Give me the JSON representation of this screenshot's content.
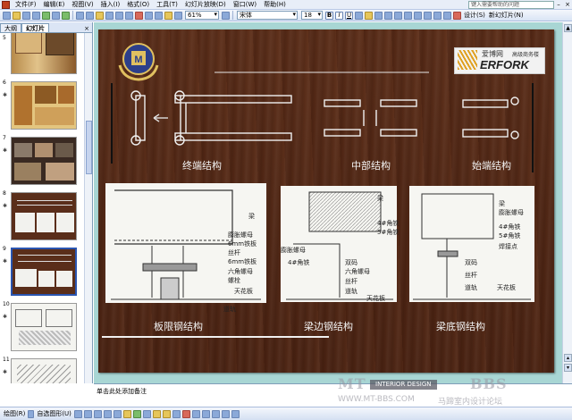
{
  "menu": [
    "文件(F)",
    "编辑(E)",
    "视图(V)",
    "插入(I)",
    "格式(O)",
    "工具(T)",
    "幻灯片放映(D)",
    "窗口(W)",
    "帮助(H)"
  ],
  "help_box": "键入需要帮助的问题",
  "toolbar": {
    "zoom": "61%",
    "font": "宋体",
    "size": "18",
    "design": "设计(S)",
    "new_slide": "新幻灯片(N)"
  },
  "left_panel": {
    "tab_outline": "大纲",
    "tab_slides": "幻灯片",
    "close": "×",
    "slides": [
      {
        "num": "5"
      },
      {
        "num": "6"
      },
      {
        "num": "7"
      },
      {
        "num": "8"
      },
      {
        "num": "9"
      },
      {
        "num": "10"
      },
      {
        "num": "11"
      }
    ]
  },
  "notes_placeholder": "单击此处添加备注",
  "drawbar": {
    "draw": "绘图(R)",
    "autoshapes": "自选图形(U)"
  },
  "slide": {
    "logo_text": "ERFORK",
    "logo_cn": "爱博网",
    "logo_sub": "高级商务楼",
    "labels_top": [
      "终端结构",
      "中部结构",
      "始端结构"
    ],
    "labels_bottom": [
      "板限钢结构",
      "梁边钢结构",
      "梁底钢结构"
    ],
    "panel1": {
      "items": [
        "梁",
        "膨胀螺母",
        "6mm铁板",
        "丝杆",
        "6mm铁板",
        "六角螺母",
        "螺栓",
        "天花板",
        "道轨"
      ]
    },
    "panel2": {
      "items": [
        "梁",
        "4#角铁",
        "5#角铁",
        "膨胀螺母",
        "4#角铁",
        "双码",
        "六角螺母",
        "丝杆",
        "道轨",
        "天花板"
      ]
    },
    "panel3": {
      "items": [
        "梁",
        "膨胀螺母",
        "4#角铁",
        "5#角铁",
        "焊接点",
        "双码",
        "丝杆",
        "道轨",
        "天花板"
      ]
    }
  },
  "watermark": {
    "big1": "MT",
    "big2": "BBS",
    "mid": "INTERIOR DESIGN",
    "url": "WWW.MT-BBS.COM",
    "cn": "马蹄室内设计论坛"
  }
}
